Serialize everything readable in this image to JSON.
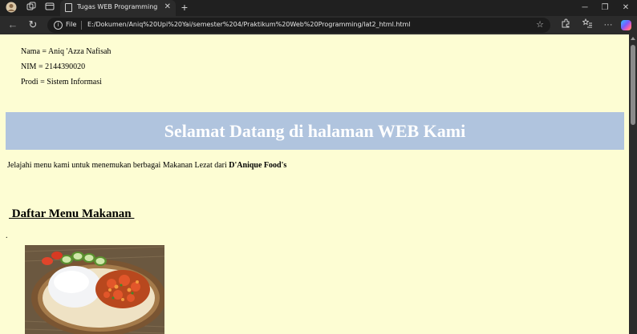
{
  "browser": {
    "tab_title": "Tugas WEB Programming",
    "address_scheme_label": "File",
    "address_url": "E:/Dokumen/Aniq%20Upi%20Yai/semester%204/Praktikum%20Web%20Programming/lat2_html.html"
  },
  "page": {
    "student": {
      "nama": "Nama  = Aniq 'Azza Nafisah",
      "nim": "NIM   = 2144390020",
      "prodi": "Prodi = Sistem Informasi"
    },
    "banner_title": "Selamat Datang di halaman WEB Kami",
    "banner_bg": "#b0c4de",
    "intro_text": "Jelajahi menu kami untuk menemukan berbagai Makanan Lezat dari ",
    "intro_brand": "D'Anique Food's",
    "menu_heading": " Daftar Menu Makanan ",
    "stray_dot": ".",
    "background": "#fdfdd3"
  }
}
